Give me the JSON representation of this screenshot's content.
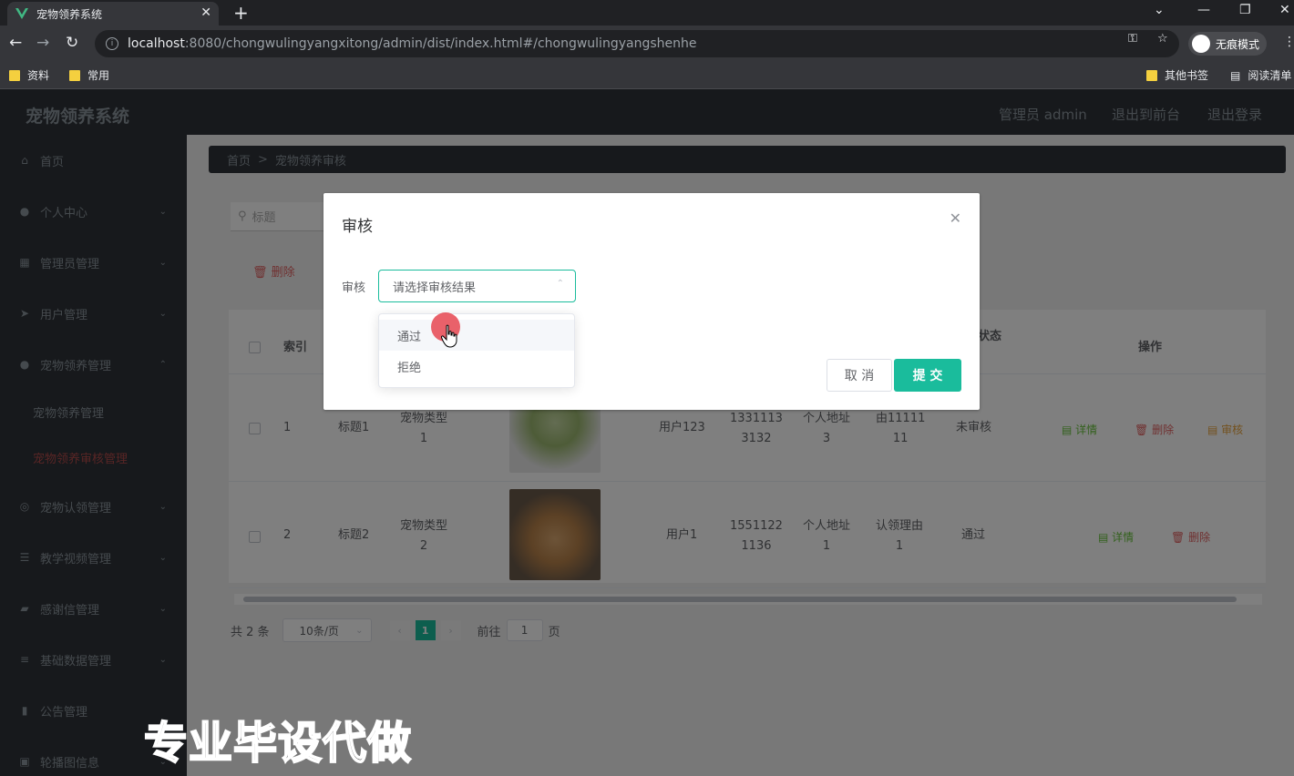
{
  "browser": {
    "tab_title": "宠物领养系统",
    "url_host": "localhost",
    "url_path": ":8080/chongwulingyangxitong/admin/dist/index.html#/chongwulingyangshenhe",
    "incognito_label": "无痕模式",
    "bookmarks": [
      "资料",
      "常用"
    ],
    "bookmarks_right": [
      "其他书签",
      "阅读清单"
    ]
  },
  "header": {
    "brand": "宠物领养系统",
    "user": "管理员 admin",
    "back_front": "退出到前台",
    "logout": "退出登录"
  },
  "sidebar": {
    "items": [
      {
        "label": "首页"
      },
      {
        "label": "个人中心"
      },
      {
        "label": "管理员管理"
      },
      {
        "label": "用户管理"
      },
      {
        "label": "宠物领养管理"
      },
      {
        "label": "宠物领养管理"
      },
      {
        "label": "宠物领养审核管理"
      },
      {
        "label": "宠物认领管理"
      },
      {
        "label": "教学视频管理"
      },
      {
        "label": "感谢信管理"
      },
      {
        "label": "基础数据管理"
      },
      {
        "label": "公告管理"
      },
      {
        "label": "轮播图信息"
      }
    ]
  },
  "breadcrumb": {
    "home": "首页",
    "sep": ">",
    "current": "宠物领养审核"
  },
  "search": {
    "placeholder": "标题"
  },
  "actions": {
    "delete": "删除"
  },
  "table": {
    "headers": {
      "index": "索引",
      "status": "状态",
      "ops": "操作"
    },
    "rows": [
      {
        "index": "1",
        "title": "标题1",
        "type": "宠物类型\n1",
        "user": "用户123",
        "phone": "1331113\n3132",
        "address": "个人地址\n3",
        "reason": "认领理由\n由11111\n11",
        "status": "未审核",
        "detail": "详情",
        "delete": "删除",
        "audit": "审核"
      },
      {
        "index": "2",
        "title": "标题2",
        "type": "宠物类型\n2",
        "user": "用户1",
        "phone": "1551122\n1136",
        "address": "个人地址\n1",
        "reason": "认领理由\n1",
        "status": "通过",
        "detail": "详情",
        "delete": "删除"
      }
    ]
  },
  "pager": {
    "total": "共 2 条",
    "size": "10条/页",
    "current": "1",
    "goto": "前往",
    "page_input": "1",
    "page_unit": "页"
  },
  "dialog": {
    "title": "审核",
    "label": "审核",
    "select_placeholder": "请选择审核结果",
    "options": [
      "通过",
      "拒绝"
    ],
    "cancel": "取 消",
    "submit": "提 交"
  },
  "watermark": "专业毕设代做",
  "colors": {
    "accent": "#1abc9c",
    "sidebar_bg": "#2f3338",
    "danger": "#e06262",
    "active_menu": "#b34a4a"
  }
}
